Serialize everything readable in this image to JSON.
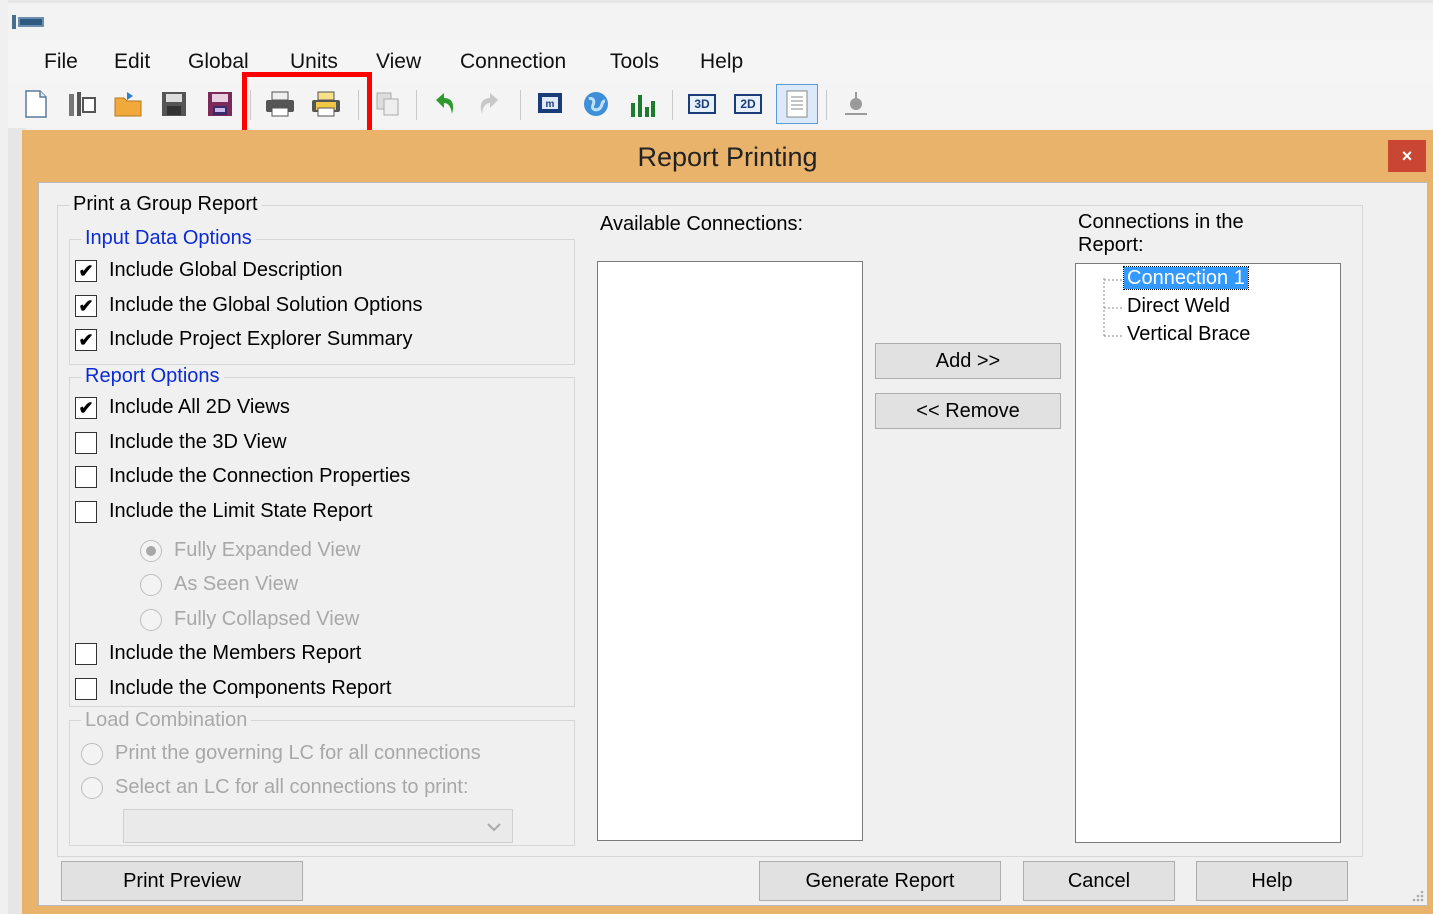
{
  "menu": [
    "File",
    "Edit",
    "Global",
    "Units",
    "View",
    "Connection",
    "Tools",
    "Help"
  ],
  "toolbar": {
    "icons": [
      "new-document-icon",
      "open-project-icon",
      "open-folder-icon",
      "save-icon",
      "save-as-icon",
      "print-icon",
      "print-report-icon",
      "copy-icon",
      "undo-icon",
      "redo-icon",
      "model-icon",
      "globe-icon",
      "chart-icon",
      "view-3d-icon",
      "view-2d-icon",
      "report-page-icon",
      "settings-icon"
    ],
    "view_3d_label": "3D",
    "view_2d_label": "2D",
    "highlight_color": "#ff0000"
  },
  "dialog": {
    "title": "Report Printing",
    "close_label": "×",
    "accent_color": "#e9b36b",
    "print_group_title": "Print a Group Report",
    "input_data_options": {
      "title": "Input Data Options",
      "items": [
        {
          "label": "Include Global Description",
          "checked": true
        },
        {
          "label": "Include the Global Solution Options",
          "checked": true
        },
        {
          "label": "Include Project Explorer Summary",
          "checked": true
        }
      ]
    },
    "report_options": {
      "title": "Report Options",
      "items": [
        {
          "label": "Include All 2D Views",
          "checked": true
        },
        {
          "label": "Include the 3D View",
          "checked": false
        },
        {
          "label": "Include the Connection Properties",
          "checked": false
        },
        {
          "label": "Include the Limit State Report",
          "checked": false
        }
      ],
      "view_modes": [
        {
          "label": "Fully Expanded View",
          "selected": true
        },
        {
          "label": "As Seen View",
          "selected": false
        },
        {
          "label": "Fully Collapsed View",
          "selected": false
        }
      ],
      "more_items": [
        {
          "label": "Include the Members Report",
          "checked": false
        },
        {
          "label": "Include the Components Report",
          "checked": false
        }
      ]
    },
    "load_combination": {
      "title": "Load Combination",
      "options": [
        {
          "label": "Print the governing LC for all connections",
          "selected": false
        },
        {
          "label": "Select an LC for all connections to print:",
          "selected": false
        }
      ],
      "combo_value": ""
    },
    "available_connections": {
      "label": "Available Connections:",
      "items": []
    },
    "add_label": "Add      >>",
    "remove_label": "<< Remove",
    "report_connections": {
      "label_line1": "Connections in the",
      "label_line2": "Report:",
      "items": [
        "Connection 1",
        "Direct Weld",
        "Vertical Brace"
      ],
      "selected_index": 0
    },
    "buttons": {
      "print_preview": "Print Preview",
      "generate_report": "Generate Report",
      "cancel": "Cancel",
      "help": "Help"
    }
  }
}
